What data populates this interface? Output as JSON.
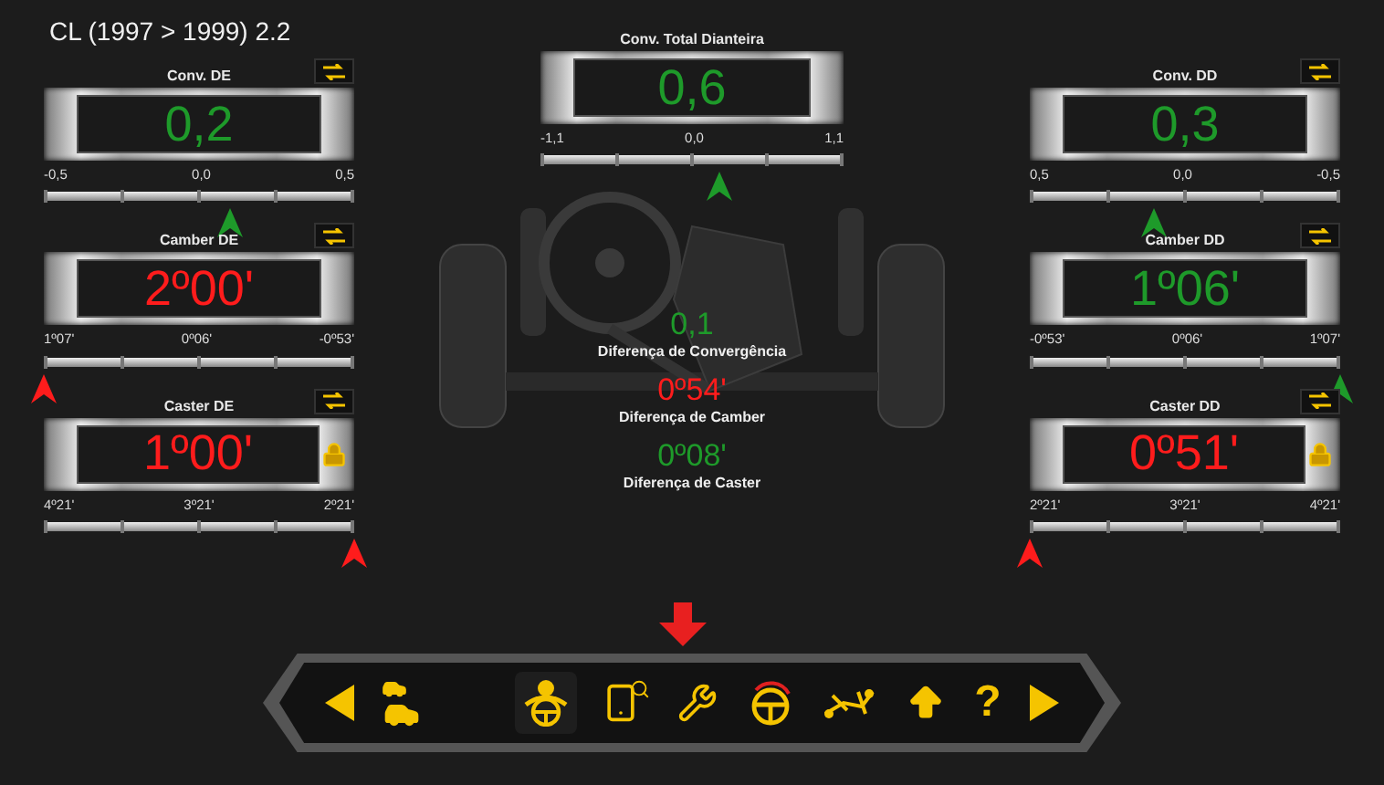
{
  "title": "CL (1997 > 1999) 2.2",
  "left": [
    {
      "title": "Conv. DE",
      "value": "0,2",
      "in_range": true,
      "scale": [
        "-0,5",
        "0,0",
        "0,5"
      ],
      "level": 0.6,
      "locked": false
    },
    {
      "title": "Camber DE",
      "value": "2º00'",
      "in_range": false,
      "scale": [
        "1º07'",
        "0º06'",
        "-0º53'"
      ],
      "level": 0,
      "locked": false
    },
    {
      "title": "Caster DE",
      "value": "1º00'",
      "in_range": false,
      "scale": [
        "4º21'",
        "3º21'",
        "2º21'"
      ],
      "level": 1,
      "locked": true
    }
  ],
  "center": {
    "gauge": {
      "title": "Conv. Total Dianteira",
      "value": "0,6",
      "in_range": true,
      "scale": [
        "-1,1",
        "0,0",
        "1,1"
      ],
      "level": 0.59
    },
    "differences": [
      {
        "value": "0,1",
        "label": "Diferença de Convergência",
        "in_range": true
      },
      {
        "value": "0º54'",
        "label": "Diferença de Camber",
        "in_range": false
      },
      {
        "value": "0º08'",
        "label": "Diferença de Caster",
        "in_range": true
      }
    ]
  },
  "right": [
    {
      "title": "Conv. DD",
      "value": "0,3",
      "in_range": true,
      "scale": [
        "0,5",
        "0,0",
        "-0,5"
      ],
      "level": 0.4,
      "locked": false
    },
    {
      "title": "Camber DD",
      "value": "1º06'",
      "in_range": true,
      "scale": [
        "-0º53'",
        "0º06'",
        "1º07'"
      ],
      "level": 1,
      "locked": false
    },
    {
      "title": "Caster DD",
      "value": "0º51'",
      "in_range": false,
      "scale": [
        "2º21'",
        "3º21'",
        "4º21'"
      ],
      "level": 0,
      "locked": true
    }
  ],
  "toolbar": [
    {
      "kind": "prev",
      "selected": false
    },
    {
      "kind": "cars",
      "selected": false
    },
    {
      "kind": "driver",
      "selected": true
    },
    {
      "kind": "device-search",
      "selected": false
    },
    {
      "kind": "tools",
      "selected": false
    },
    {
      "kind": "steering",
      "selected": false
    },
    {
      "kind": "chassis",
      "selected": false
    },
    {
      "kind": "up",
      "selected": false
    },
    {
      "kind": "help",
      "label": "?",
      "selected": false
    },
    {
      "kind": "next",
      "selected": false
    }
  ]
}
